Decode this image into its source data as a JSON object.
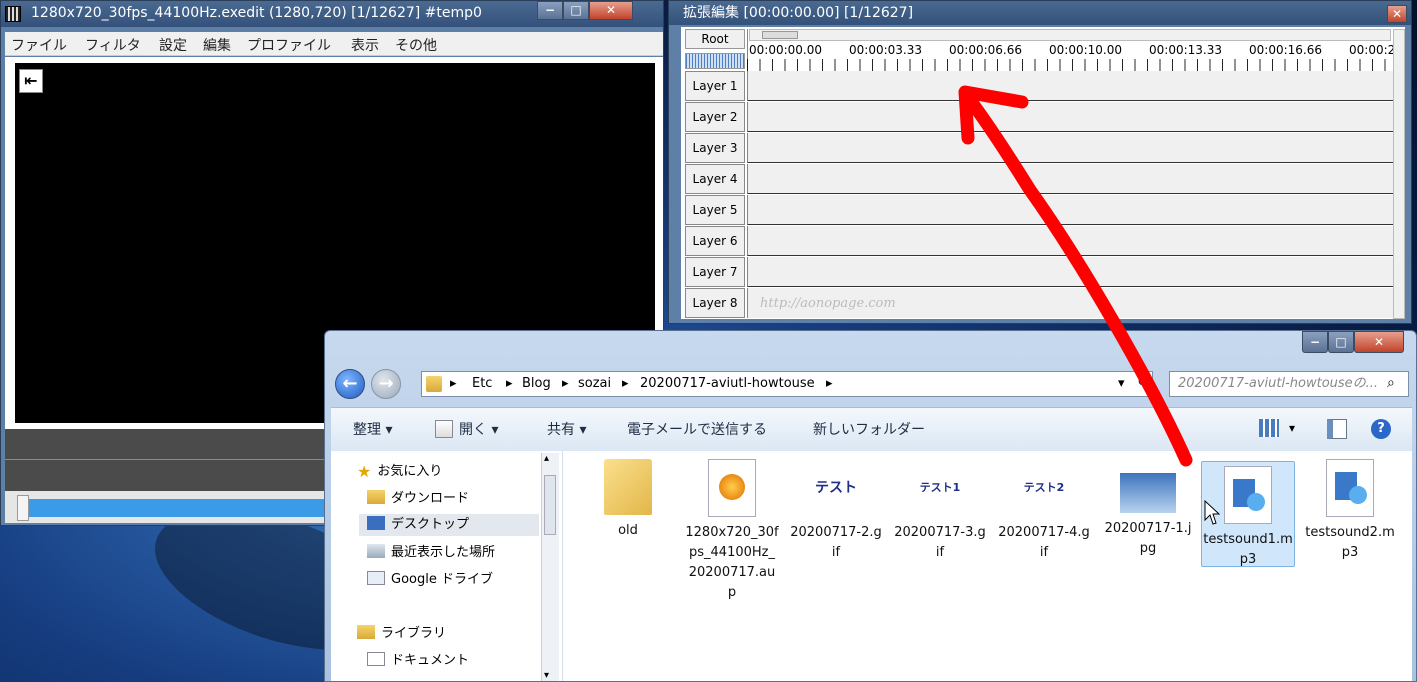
{
  "main_window": {
    "title": "1280x720_30fps_44100Hz.exedit (1280,720)  [1/12627]  #temp0",
    "menu": [
      "ファイル",
      "フィルタ",
      "設定",
      "編集",
      "プロファイル",
      "表示",
      "その他"
    ],
    "jump_icon": "jump-start-icon"
  },
  "timeline_window": {
    "title": "拡張編集 [00:00:00.00] [1/12627]",
    "root_label": "Root",
    "time_labels": [
      "00:00:00.00",
      "00:00:03.33",
      "00:00:06.66",
      "00:00:10.00",
      "00:00:13.33",
      "00:00:16.66",
      "00:00:2"
    ],
    "layers": [
      "Layer 1",
      "Layer 2",
      "Layer 3",
      "Layer 4",
      "Layer 5",
      "Layer 6",
      "Layer 7",
      "Layer 8"
    ],
    "watermark": "http://aonopage.com"
  },
  "explorer": {
    "breadcrumb": [
      "Etc",
      "Blog",
      "sozai",
      "20200717-aviutl-howtouse"
    ],
    "search_placeholder": "20200717-aviutl-howtouseの...",
    "toolbar": {
      "organize": "整理 ▾",
      "open": "開く ▾",
      "share": "共有 ▾",
      "email": "電子メールで送信する",
      "new_folder": "新しいフォルダー"
    },
    "nav": {
      "favorites": "お気に入り",
      "downloads": "ダウンロード",
      "desktop": "デスクトップ",
      "recent": "最近表示した場所",
      "google_drive": "Google ドライブ",
      "libraries": "ライブラリ",
      "documents": "ドキュメント"
    },
    "files": [
      {
        "name": "old",
        "kind": "folder"
      },
      {
        "name": "1280x720_30fps_44100Hz_20200717.aup",
        "kind": "aup"
      },
      {
        "name": "20200717-2.gif",
        "kind": "gif",
        "thumb": "テスト"
      },
      {
        "name": "20200717-3.gif",
        "kind": "gif",
        "thumb": "テスト1"
      },
      {
        "name": "20200717-4.gif",
        "kind": "gif",
        "thumb": "テスト2"
      },
      {
        "name": "20200717-1.jpg",
        "kind": "jpg"
      },
      {
        "name": "testsound1.mp3",
        "kind": "mp3",
        "selected": true
      },
      {
        "name": "testsound2.mp3",
        "kind": "mp3"
      }
    ]
  },
  "colors": {
    "annotation_arrow": "#ff0000",
    "selection": "#cfe6fb"
  }
}
